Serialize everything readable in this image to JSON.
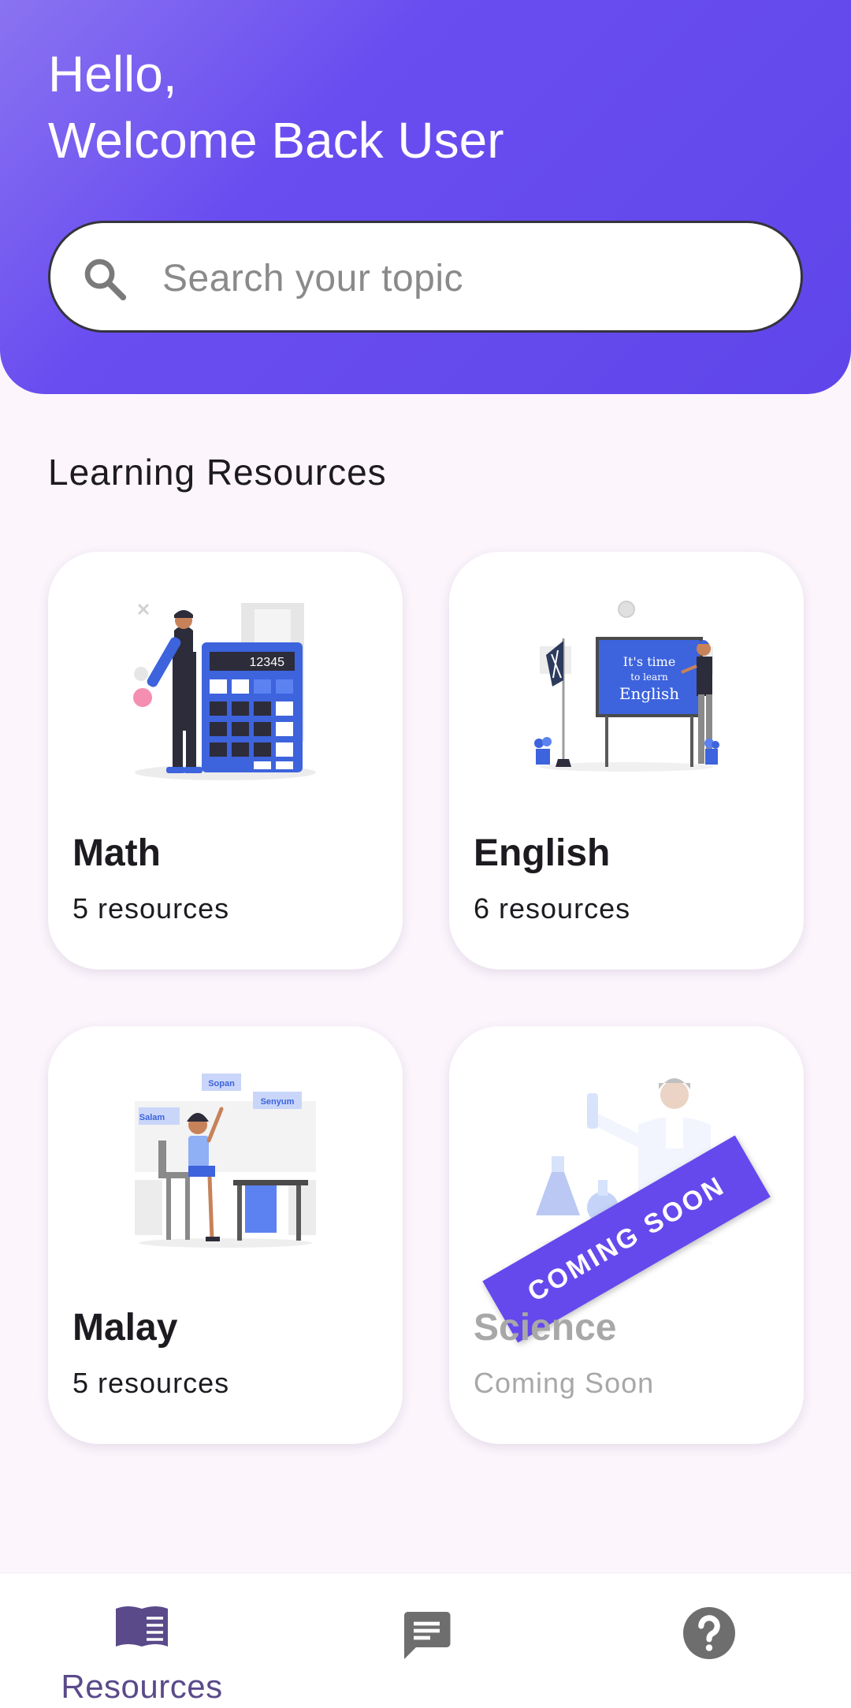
{
  "header": {
    "greeting_line1": "Hello,",
    "greeting_line2": "Welcome Back User",
    "search_placeholder": "Search your topic",
    "search_icon": "search-icon"
  },
  "section": {
    "title": "Learning Resources"
  },
  "cards": [
    {
      "title": "Math",
      "subtitle": "5 resources",
      "illustration": "math-calculator-illustration"
    },
    {
      "title": "English",
      "subtitle": "6 resources",
      "illustration": "english-classroom-illustration",
      "board_text": "It's time to learn English"
    },
    {
      "title": "Malay",
      "subtitle": "5 resources",
      "illustration": "malay-student-illustration",
      "bubbles": [
        "Salam",
        "Sopan",
        "Senyum"
      ]
    },
    {
      "title": "Science",
      "subtitle": "Coming Soon",
      "illustration": "science-lab-illustration",
      "ribbon": "COMING SOON"
    }
  ],
  "math_calc_display": "12345",
  "bottom_nav": {
    "items": [
      {
        "label": "Resources",
        "icon": "book-icon",
        "active": true
      },
      {
        "label": "",
        "icon": "chat-icon",
        "active": false
      },
      {
        "label": "",
        "icon": "help-icon",
        "active": false
      }
    ]
  },
  "colors": {
    "primary": "#6549ed",
    "header_gradient_start": "#8a73f1",
    "background": "#fcf5fc",
    "nav_active": "#5a4a8a",
    "nav_inactive": "#6e6e6e"
  }
}
